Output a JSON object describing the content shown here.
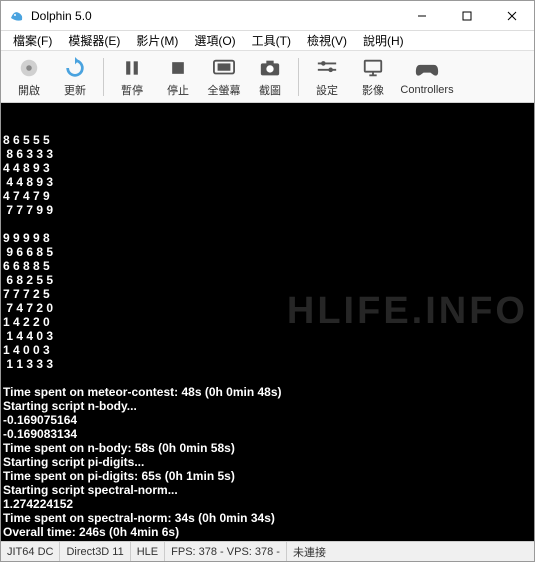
{
  "window": {
    "title": "Dolphin 5.0",
    "min_label": "min",
    "max_label": "max",
    "close_label": "close"
  },
  "menu": {
    "file": "檔案(F)",
    "emulator": "模擬器(E)",
    "movie": "影片(M)",
    "options": "選項(O)",
    "tools": "工具(T)",
    "view": "檢視(V)",
    "help": "說明(H)"
  },
  "toolbar": {
    "open": "開啟",
    "refresh": "更新",
    "pause": "暫停",
    "stop": "停止",
    "fullscreen": "全螢幕",
    "screenshot": "截圖",
    "settings": "設定",
    "graphics": "影像",
    "controllers": "Controllers"
  },
  "console_lines": [
    "8 6 5 5 5",
    " 8 6 3 3 3",
    "4 4 8 9 3",
    " 4 4 8 9 3",
    "4 7 4 7 9",
    " 7 7 7 9 9",
    "",
    "9 9 9 9 8",
    " 9 6 6 8 5",
    "6 6 8 8 5",
    " 6 8 2 5 5",
    "7 7 7 2 5",
    " 7 4 7 2 0",
    "1 4 2 2 0",
    " 1 4 4 0 3",
    "1 4 0 0 3",
    " 1 1 3 3 3",
    "",
    "Time spent on meteor-contest: 48s (0h 0min 48s)",
    "Starting script n-body...",
    "-0.169075164",
    "-0.169083134",
    "Time spent on n-body: 58s (0h 0min 58s)",
    "Starting script pi-digits...",
    "Time spent on pi-digits: 65s (0h 1min 5s)",
    "Starting script spectral-norm...",
    "1.274224152",
    "Time spent on spectral-norm: 34s (0h 0min 34s)",
    "Overall time: 246s (0h 4min 6s)"
  ],
  "watermark": "HLIFE.INFO",
  "status": {
    "jit": "JIT64 DC",
    "backend": "Direct3D 11",
    "hle": "HLE",
    "fps": "FPS: 378 - VPS: 378 -",
    "conn": "未連接"
  }
}
